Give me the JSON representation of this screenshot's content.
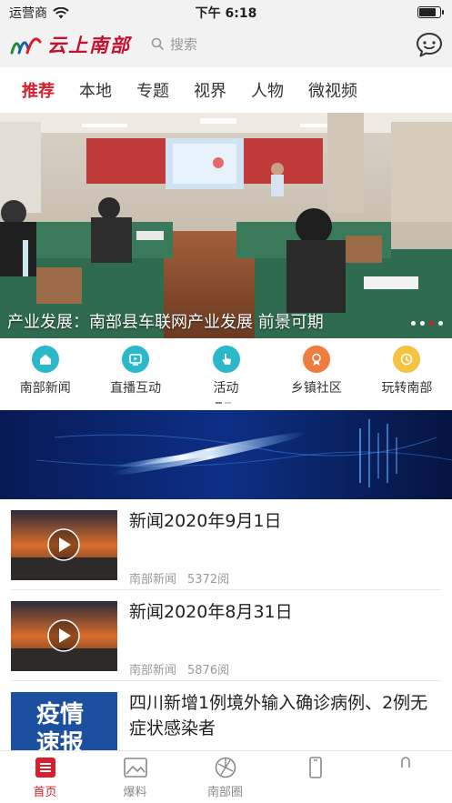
{
  "status_bar": {
    "carrier": "运营商",
    "time": "下午 6:18",
    "battery_level": 0.85
  },
  "header": {
    "logo_text": "云上南部",
    "search_placeholder": "搜索",
    "chat_icon": "chat-bubble-icon"
  },
  "tabs": [
    {
      "label": "推荐",
      "active": true
    },
    {
      "label": "本地"
    },
    {
      "label": "专题"
    },
    {
      "label": "视界"
    },
    {
      "label": "人物"
    },
    {
      "label": "微视频"
    }
  ],
  "banner": {
    "caption": "产业发展：南部县车联网产业发展 前景可期",
    "slide_count": 4,
    "active_slide": 2
  },
  "quick_nav": [
    {
      "label": "南部新闻",
      "icon": "home-icon",
      "color": "#2bb8c9"
    },
    {
      "label": "直播互动",
      "icon": "live-tv-icon",
      "color": "#2bb8c9"
    },
    {
      "label": "活动",
      "icon": "hand-pointer-icon",
      "color": "#2bb8c9"
    },
    {
      "label": "乡镇社区",
      "icon": "medal-icon",
      "color": "#f07b3f"
    },
    {
      "label": "玩转南部",
      "icon": "clock-icon",
      "color": "#f5c242"
    }
  ],
  "news": [
    {
      "title": "新闻2020年9月1日",
      "source": "南部新闻",
      "reads": "5372阅",
      "type": "video"
    },
    {
      "title": "新闻2020年8月31日",
      "source": "南部新闻",
      "reads": "5876阅",
      "type": "video"
    },
    {
      "title": "四川新增1例境外输入确诊病例、2例无症状感染者",
      "thumb_text_1": "疫情",
      "thumb_text_2": "速报",
      "type": "image"
    }
  ],
  "bottom_nav": [
    {
      "label": "首页",
      "icon": "home-list-icon",
      "active": true
    },
    {
      "label": "爆料",
      "icon": "image-icon"
    },
    {
      "label": "南部圈",
      "icon": "circle-icon"
    },
    {
      "label": "",
      "icon": "phone-icon"
    },
    {
      "label": "",
      "icon": "person-icon"
    }
  ],
  "colors": {
    "accent": "#d81e2a",
    "header_bg": "#f2f2f2"
  }
}
